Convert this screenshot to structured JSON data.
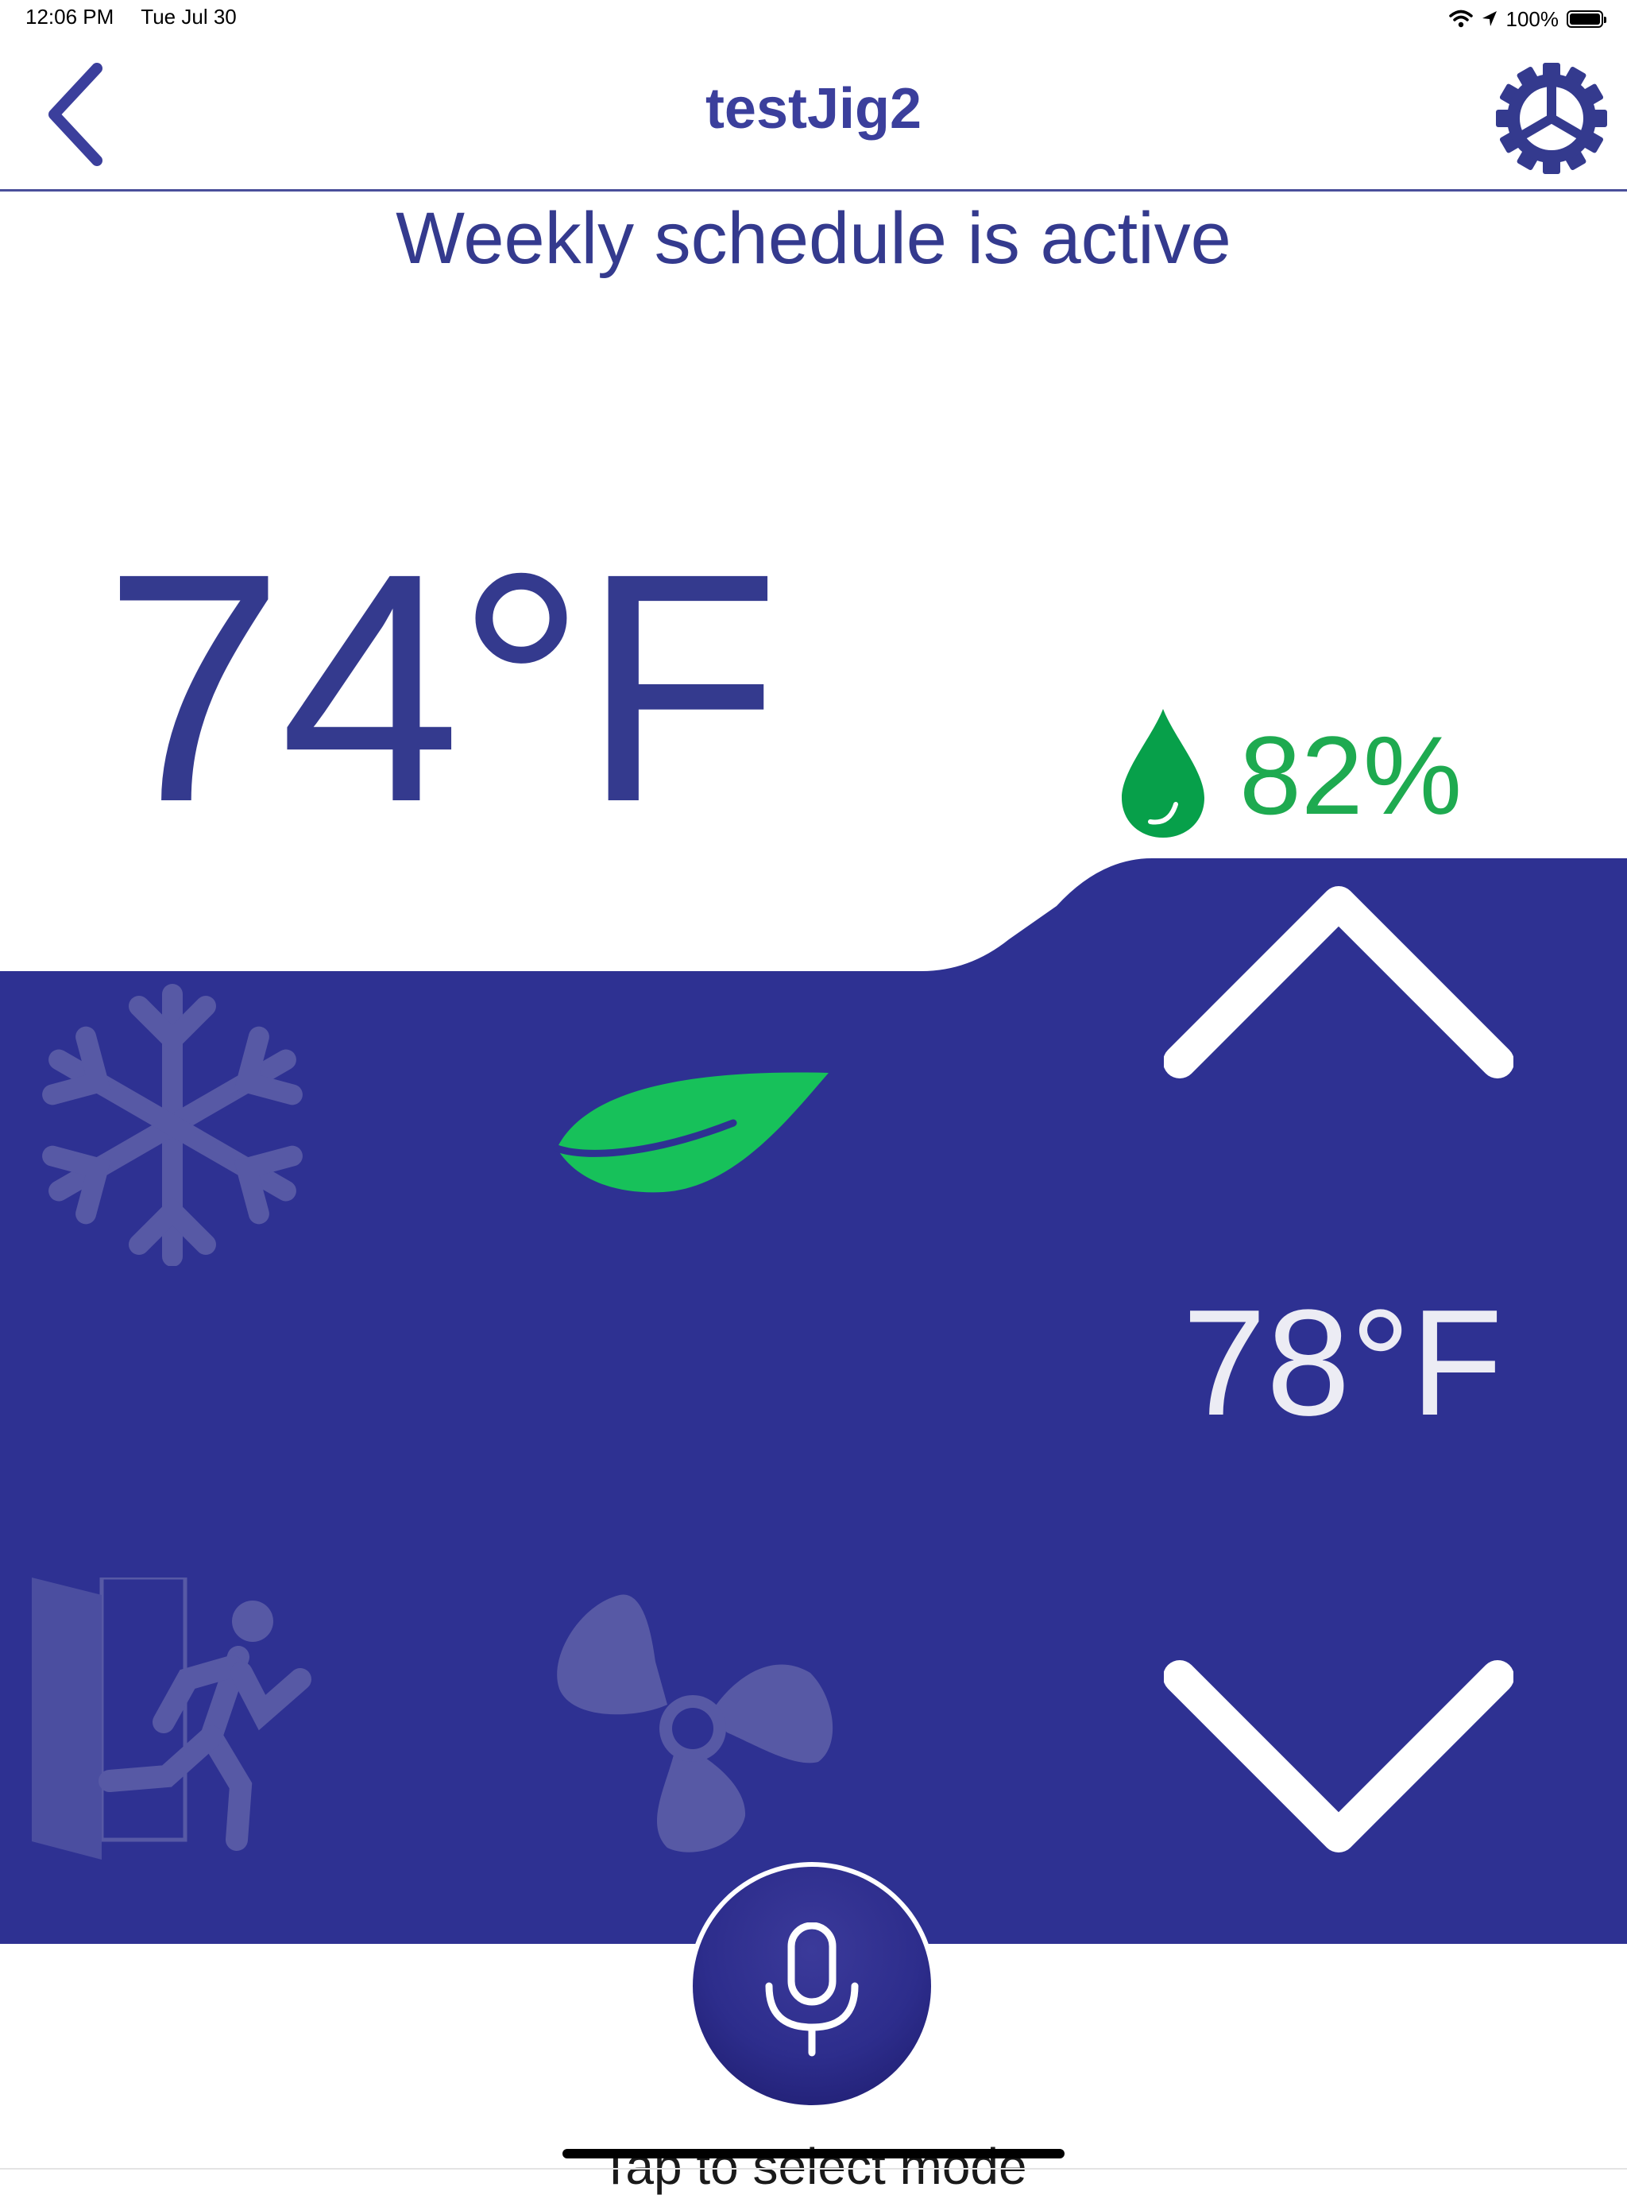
{
  "status_bar": {
    "time": "12:06 PM",
    "date": "Tue Jul 30",
    "battery": "100%",
    "icons": [
      "wifi-icon",
      "location-icon",
      "battery-icon"
    ]
  },
  "nav": {
    "title": "testJig2",
    "back_icon": "chevron-left-icon",
    "settings_icon": "gear-icon"
  },
  "schedule_status": "Weekly schedule is active",
  "current": {
    "temperature": "74°F",
    "humidity": "82%",
    "humidity_icon": "water-drop-icon"
  },
  "setpoint": {
    "temperature": "78°F",
    "increase_icon": "chevron-up-icon",
    "decrease_icon": "chevron-down-icon"
  },
  "modes": [
    {
      "name": "cool",
      "icon": "snowflake-icon",
      "active": false
    },
    {
      "name": "eco",
      "icon": "leaf-icon",
      "active": true
    },
    {
      "name": "away",
      "icon": "exit-icon",
      "active": false
    },
    {
      "name": "fan",
      "icon": "fan-icon",
      "active": false
    }
  ],
  "voice": {
    "icon": "microphone-icon"
  },
  "hint": "Tap to select mode",
  "colors": {
    "primary": "#2e3192",
    "title": "#343a8e",
    "humidity": "#1eaa50",
    "eco_active": "#17c15a",
    "inactive_icon": "#5759a5",
    "background": "#ffffff"
  }
}
